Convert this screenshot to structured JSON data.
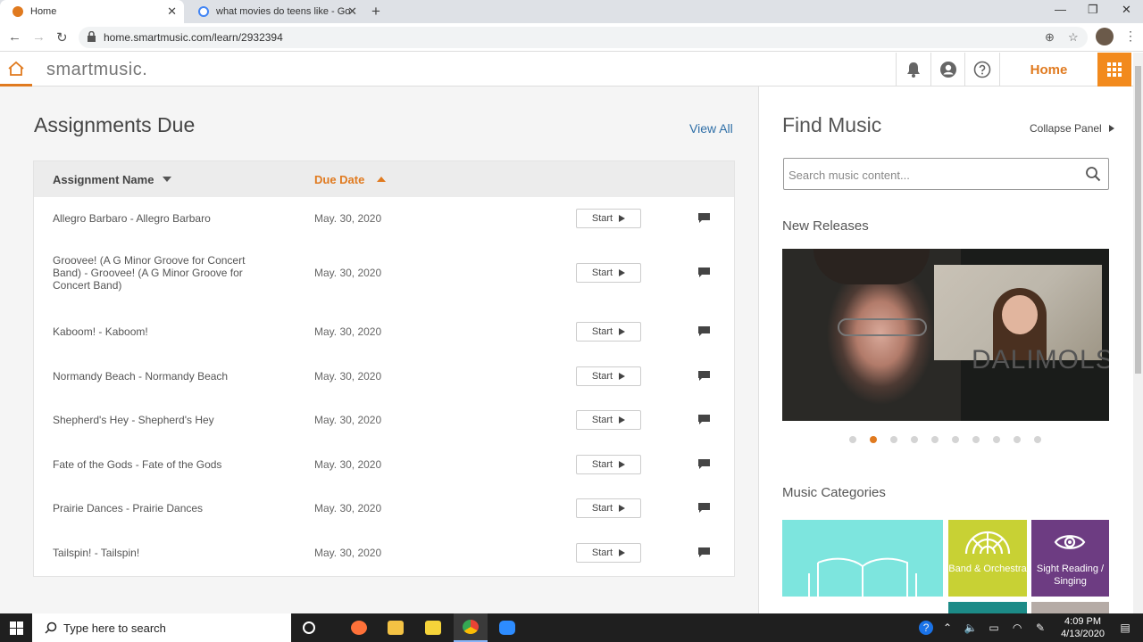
{
  "browser": {
    "tabs": [
      {
        "title": "Home",
        "active": true,
        "favicon_color": "#e07a1f"
      },
      {
        "title": "what movies do teens like - Goo",
        "active": false,
        "favicon_color": "#4285f4"
      }
    ],
    "url": "home.smartmusic.com/learn/2932394"
  },
  "header": {
    "logo": "smartmusic.",
    "home_label": "Home",
    "accent_color": "#e07a1f"
  },
  "assignments": {
    "title": "Assignments Due",
    "view_all": "View All",
    "columns": {
      "name": "Assignment Name",
      "due": "Due Date"
    },
    "start_label": "Start",
    "rows": [
      {
        "name": "Allegro Barbaro - Allegro Barbaro",
        "due": "May. 30, 2020"
      },
      {
        "name": "Groovee! (A G Minor Groove for Concert Band) - Groovee! (A G Minor Groove for Concert Band)",
        "due": "May. 30, 2020"
      },
      {
        "name": "Kaboom! - Kaboom!",
        "due": "May. 30, 2020"
      },
      {
        "name": "Normandy Beach - Normandy Beach",
        "due": "May. 30, 2020"
      },
      {
        "name": "Shepherd's Hey - Shepherd's Hey",
        "due": "May. 30, 2020"
      },
      {
        "name": "Fate of the Gods - Fate of the Gods",
        "due": "May. 30, 2020"
      },
      {
        "name": "Prairie Dances - Prairie Dances",
        "due": "May. 30, 2020"
      },
      {
        "name": "Tailspin! - Tailspin!",
        "due": "May. 30, 2020"
      }
    ]
  },
  "find_music": {
    "title": "Find Music",
    "collapse_label": "Collapse Panel",
    "search_placeholder": "Search music content...",
    "new_releases_title": "New Releases",
    "video_caption": "DALIMOLS",
    "carousel": {
      "total": 10,
      "active": 2
    },
    "categories_title": "Music Categories",
    "categories": [
      {
        "label": "",
        "color": "#7de5de",
        "icon": "book-icon"
      },
      {
        "label": "Band & Orchestra",
        "color": "#c8d134",
        "icon": "band-orchestra-icon"
      },
      {
        "label": "Sight Reading / Singing",
        "color": "#6d3c82",
        "icon": "eye-icon"
      }
    ]
  },
  "taskbar": {
    "search_text": "Type here to search",
    "time": "4:09 PM",
    "date": "4/13/2020"
  }
}
